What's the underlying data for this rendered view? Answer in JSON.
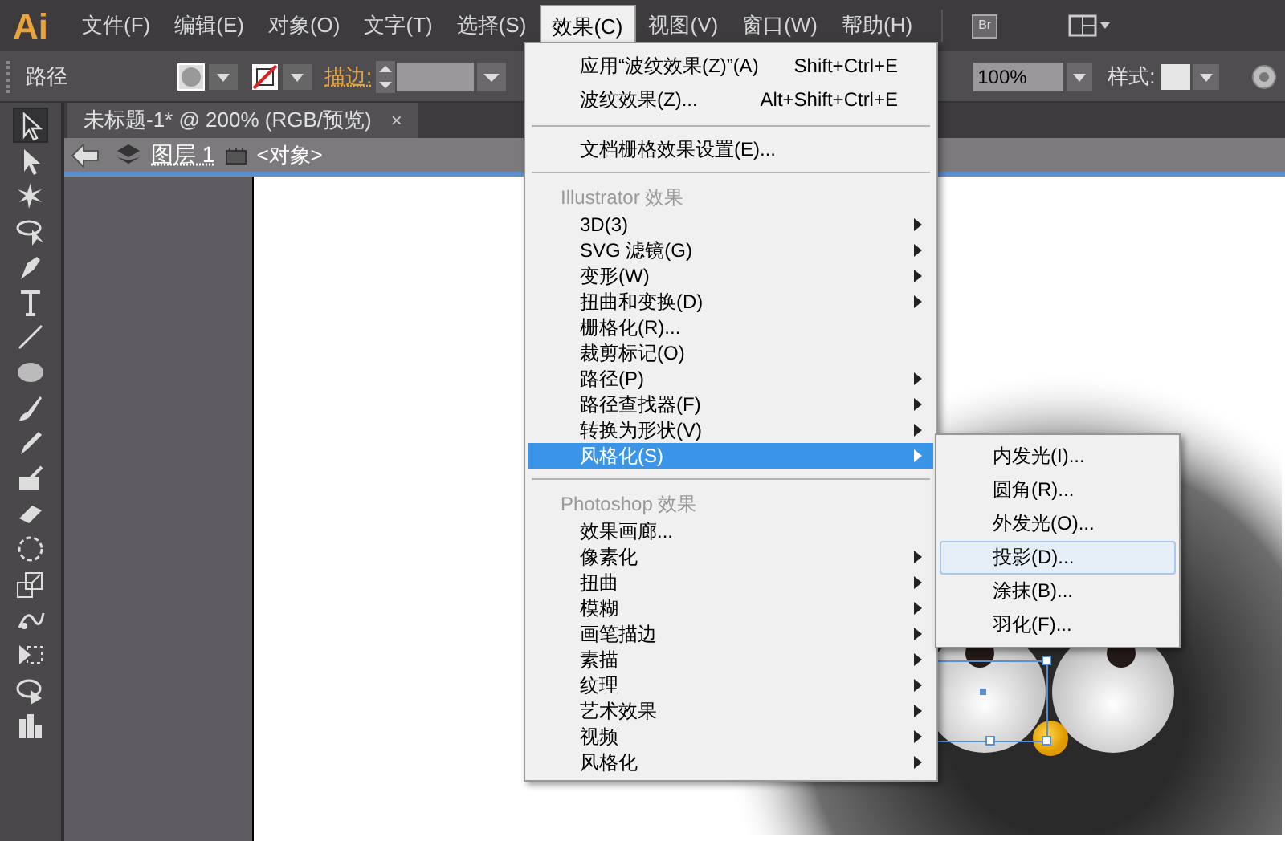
{
  "menubar": {
    "logo": "Ai",
    "items": [
      {
        "label": "文件(F)",
        "selected": false
      },
      {
        "label": "编辑(E)",
        "selected": false
      },
      {
        "label": "对象(O)",
        "selected": false
      },
      {
        "label": "文字(T)",
        "selected": false
      },
      {
        "label": "选择(S)",
        "selected": false
      },
      {
        "label": "效果(C)",
        "selected": true
      },
      {
        "label": "视图(V)",
        "selected": false
      },
      {
        "label": "窗口(W)",
        "selected": false
      },
      {
        "label": "帮助(H)",
        "selected": false
      }
    ],
    "bridge": "Br"
  },
  "control_bar": {
    "selection": "路径",
    "stroke_label": "描边:",
    "opacity": "100%",
    "style_label": "样式:"
  },
  "document_tab": {
    "title": "未标题-1* @ 200% (RGB/预览)",
    "close": "×"
  },
  "breadcrumb": {
    "layer": "图层 1",
    "object": "<对象>"
  },
  "effect_menu": [
    {
      "kind": "item",
      "label": "应用“波纹效果(Z)”(A)",
      "shortcut": "Shift+Ctrl+E",
      "submenu": false,
      "selected": false
    },
    {
      "kind": "item",
      "label": "波纹效果(Z)...",
      "shortcut": "Alt+Shift+Ctrl+E",
      "submenu": false,
      "selected": false
    },
    {
      "kind": "separator"
    },
    {
      "kind": "item",
      "label": "文档栅格效果设置(E)...",
      "submenu": false,
      "selected": false
    },
    {
      "kind": "separator"
    },
    {
      "kind": "header",
      "label": "Illustrator 效果"
    },
    {
      "kind": "item",
      "label": "3D(3)",
      "submenu": true,
      "selected": false
    },
    {
      "kind": "item",
      "label": "SVG 滤镜(G)",
      "submenu": true,
      "selected": false
    },
    {
      "kind": "item",
      "label": "变形(W)",
      "submenu": true,
      "selected": false
    },
    {
      "kind": "item",
      "label": "扭曲和变换(D)",
      "submenu": true,
      "selected": false
    },
    {
      "kind": "item",
      "label": "栅格化(R)...",
      "submenu": false,
      "selected": false
    },
    {
      "kind": "item",
      "label": "裁剪标记(O)",
      "submenu": false,
      "selected": false
    },
    {
      "kind": "item",
      "label": "路径(P)",
      "submenu": true,
      "selected": false
    },
    {
      "kind": "item",
      "label": "路径查找器(F)",
      "submenu": true,
      "selected": false
    },
    {
      "kind": "item",
      "label": "转换为形状(V)",
      "submenu": true,
      "selected": false
    },
    {
      "kind": "item",
      "label": "风格化(S)",
      "submenu": true,
      "selected": true
    },
    {
      "kind": "separator"
    },
    {
      "kind": "header",
      "label": "Photoshop 效果"
    },
    {
      "kind": "item",
      "label": "效果画廊...",
      "submenu": false,
      "selected": false
    },
    {
      "kind": "item",
      "label": "像素化",
      "submenu": true,
      "selected": false
    },
    {
      "kind": "item",
      "label": "扭曲",
      "submenu": true,
      "selected": false
    },
    {
      "kind": "item",
      "label": "模糊",
      "submenu": true,
      "selected": false
    },
    {
      "kind": "item",
      "label": "画笔描边",
      "submenu": true,
      "selected": false
    },
    {
      "kind": "item",
      "label": "素描",
      "submenu": true,
      "selected": false
    },
    {
      "kind": "item",
      "label": "纹理",
      "submenu": true,
      "selected": false
    },
    {
      "kind": "item",
      "label": "艺术效果",
      "submenu": true,
      "selected": false
    },
    {
      "kind": "item",
      "label": "视频",
      "submenu": true,
      "selected": false
    },
    {
      "kind": "item",
      "label": "风格化",
      "submenu": true,
      "selected": false
    }
  ],
  "stylize_submenu": [
    {
      "label": "内发光(I)...",
      "selected": false
    },
    {
      "label": "圆角(R)...",
      "selected": false
    },
    {
      "label": "外发光(O)...",
      "selected": false
    },
    {
      "label": "投影(D)...",
      "selected": true
    },
    {
      "label": "涂抹(B)...",
      "selected": false
    },
    {
      "label": "羽化(F)...",
      "selected": false
    }
  ]
}
